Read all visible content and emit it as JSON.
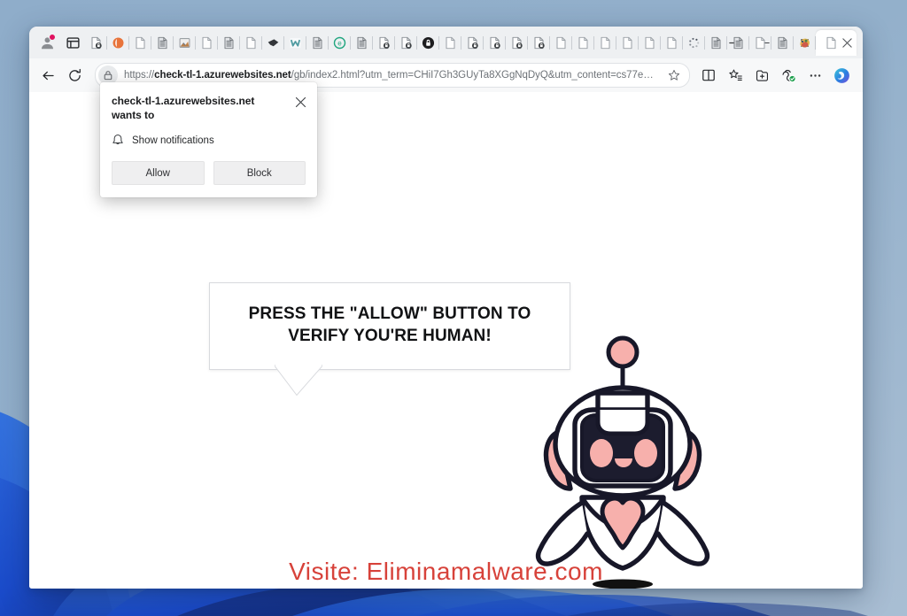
{
  "desktop": {
    "wallpaper_name": "windows-11-bloom-wallpaper",
    "background_color": "#8fadca"
  },
  "browser": {
    "name": "Microsoft Edge",
    "profile": {
      "icon": "profile-avatar-icon",
      "badge": "notification-dot"
    },
    "tab_search_icon": "tab-search-icon",
    "tabs": [
      {
        "favicon": "lock-page-icon",
        "title": ""
      },
      {
        "favicon": "orange-circle-icon",
        "title": ""
      },
      {
        "favicon": "blank-page-icon",
        "title": ""
      },
      {
        "favicon": "document-lines-icon",
        "title": ""
      },
      {
        "favicon": "image-icon",
        "title": ""
      },
      {
        "favicon": "blank-page-icon",
        "title": ""
      },
      {
        "favicon": "document-lines-icon",
        "title": ""
      },
      {
        "favicon": "blank-page-icon",
        "title": ""
      },
      {
        "favicon": "dark-arrow-icon",
        "title": ""
      },
      {
        "favicon": "w-teal-icon",
        "title": ""
      },
      {
        "favicon": "document-lines-icon",
        "title": ""
      },
      {
        "favicon": "e-circle-icon",
        "title": ""
      },
      {
        "favicon": "document-lines-icon",
        "title": ""
      },
      {
        "favicon": "lock-page-icon",
        "title": ""
      },
      {
        "favicon": "lock-page-icon",
        "title": ""
      },
      {
        "favicon": "dark-lock-page-icon",
        "title": ""
      },
      {
        "favicon": "blank-page-icon",
        "title": ""
      },
      {
        "favicon": "lock-page-icon",
        "title": ""
      },
      {
        "favicon": "lock-page-icon",
        "title": ""
      },
      {
        "favicon": "lock-page-icon",
        "title": ""
      },
      {
        "favicon": "lock-page-icon",
        "title": ""
      },
      {
        "favicon": "blank-page-icon",
        "title": ""
      },
      {
        "favicon": "blank-page-icon",
        "title": ""
      },
      {
        "favicon": "blank-page-icon",
        "title": ""
      },
      {
        "favicon": "blank-page-icon",
        "title": ""
      },
      {
        "favicon": "blank-page-icon",
        "title": ""
      },
      {
        "favicon": "blank-page-icon",
        "title": ""
      },
      {
        "favicon": "loading-spinner-icon",
        "title": ""
      },
      {
        "favicon": "document-lines-icon",
        "title": ""
      },
      {
        "favicon": "document-lines-icon",
        "title": ""
      },
      {
        "favicon": "blank-page-icon",
        "title": ""
      },
      {
        "favicon": "document-lines-icon",
        "title": ""
      },
      {
        "favicon": "colorful-blob-icon",
        "title": ""
      },
      {
        "favicon": "blank-page-icon",
        "title": "",
        "active": true
      }
    ],
    "active_tab_close_icon": "close-icon",
    "new_tab_icon": "plus-icon",
    "window_controls": {
      "minimize": "minimize-icon",
      "maximize": "maximize-icon",
      "close": "window-close-icon"
    },
    "toolbar": {
      "back_icon": "back-arrow-icon",
      "refresh_icon": "reload-icon",
      "site_info_icon": "lock-icon",
      "url_prefix": "https://",
      "url_domain": "check-tl-1.azurewebsites.net",
      "url_path": "/gb/index2.html?utm_term=CHiI7Gh3GUyTa8XGgNqDyQ&utm_content=cs77e…",
      "url_full": "https://check-tl-1.azurewebsites.net/gb/index2.html?utm_term=CHiI7Gh3GUyTa8XGgNqDyQ&utm_content=cs77e…",
      "favorite_icon": "star-outline-icon",
      "split_screen_icon": "split-screen-icon",
      "favorites_icon": "favorites-star-list-icon",
      "collections_icon": "collections-icon",
      "browser_essentials_icon": "browser-essentials-icon",
      "settings_more_icon": "ellipsis-more-icon",
      "copilot_icon": "copilot-icon"
    }
  },
  "notification_popup": {
    "title": "check-tl-1.azurewebsites.net wants to",
    "close_icon": "close-icon",
    "permission_icon": "bell-icon",
    "permission_label": "Show notifications",
    "allow_label": "Allow",
    "block_label": "Block"
  },
  "page": {
    "speech_bubble_text": "PRESS THE \"ALLOW\" BUTTON TO VERIFY YOU'RE HUMAN!",
    "robot_name": "friendly-robot-mascot",
    "watermark_text": "Visite: Eliminamalware.com",
    "colors": {
      "robot_accent_pink": "#f7b0ac",
      "robot_outline": "#171728",
      "robot_face": "#1c1c2e",
      "watermark_red": "#d4342c",
      "page_background": "#ffffff"
    }
  }
}
